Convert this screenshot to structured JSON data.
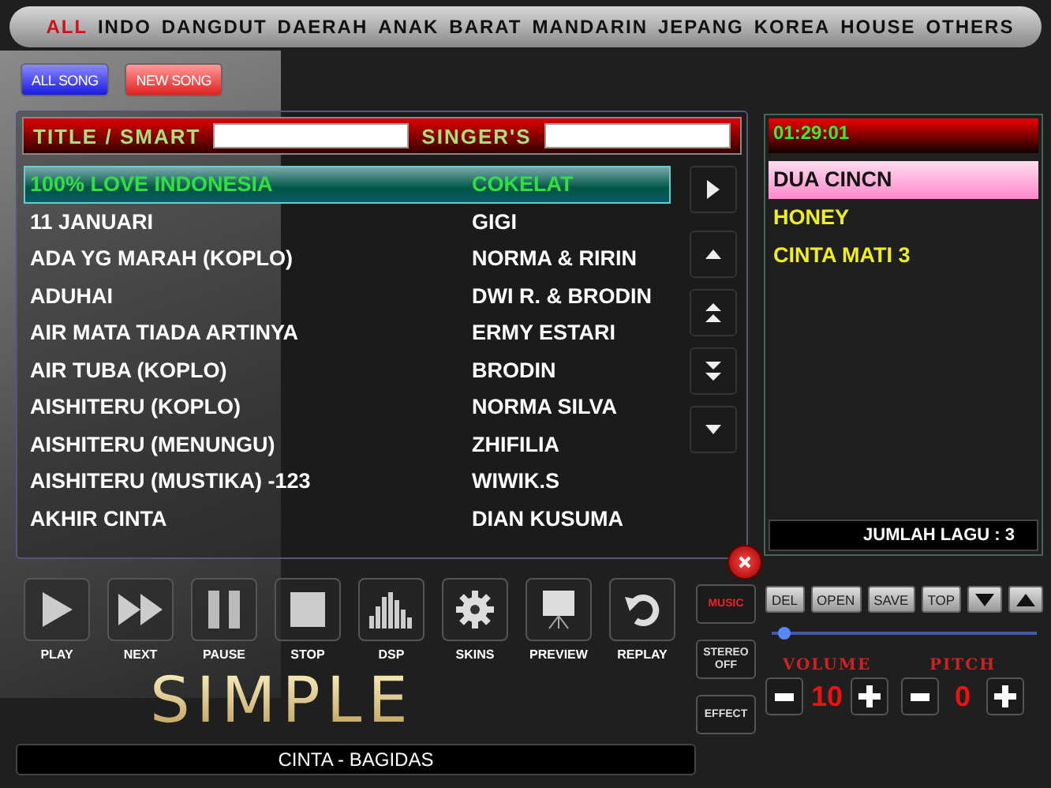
{
  "nav_tabs": [
    {
      "label": "ALL",
      "selected": true
    },
    {
      "label": "INDO",
      "selected": false
    },
    {
      "label": "DANGDUT",
      "selected": false
    },
    {
      "label": "DAERAH",
      "selected": false
    },
    {
      "label": "ANAK",
      "selected": false
    },
    {
      "label": "BARAT",
      "selected": false
    },
    {
      "label": "MANDARIN",
      "selected": false
    },
    {
      "label": "JEPANG",
      "selected": false
    },
    {
      "label": "KOREA",
      "selected": false
    },
    {
      "label": "HOUSE",
      "selected": false
    },
    {
      "label": "OTHERS",
      "selected": false
    }
  ],
  "list_buttons": [
    {
      "label": "ALL SONG",
      "kind": "all"
    },
    {
      "label": "NEW SONG",
      "kind": "new"
    }
  ],
  "search": {
    "title_label": "TITLE / SMART",
    "singer_label": "SINGER'S"
  },
  "songs": [
    {
      "title": "100% LOVE INDONESIA",
      "singer": "COKELAT",
      "selected": true
    },
    {
      "title": "11 JANUARI",
      "singer": "GIGI",
      "selected": false
    },
    {
      "title": "ADA YG MARAH (KOPLO)",
      "singer": "NORMA & RIRIN",
      "selected": false
    },
    {
      "title": "ADUHAI",
      "singer": "DWI R. & BRODIN",
      "selected": false
    },
    {
      "title": "AIR MATA TIADA ARTINYA",
      "singer": "ERMY ESTARI",
      "selected": false
    },
    {
      "title": "AIR TUBA (KOPLO)",
      "singer": "BRODIN",
      "selected": false
    },
    {
      "title": "AISHITERU (KOPLO)",
      "singer": "NORMA SILVA",
      "selected": false
    },
    {
      "title": "AISHITERU (MENUNGU)",
      "singer": "ZHIFILIA",
      "selected": false
    },
    {
      "title": "AISHITERU (MUSTIKA) -123",
      "singer": "WIWIK.S",
      "selected": false
    },
    {
      "title": "AKHIR CINTA",
      "singer": "DIAN KUSUMA",
      "selected": false
    }
  ],
  "queue": {
    "time": "01:29:01",
    "items": [
      {
        "title": "DUA CINCN",
        "selected": true
      },
      {
        "title": "HONEY",
        "selected": false
      },
      {
        "title": "CINTA MATI 3",
        "selected": false
      }
    ],
    "count": "JUMLAH LAGU : 3"
  },
  "controls": [
    {
      "label": "PLAY",
      "kind": "play"
    },
    {
      "label": "NEXT",
      "kind": "next"
    },
    {
      "label": "PAUSE",
      "kind": "pause"
    },
    {
      "label": "STOP",
      "kind": "stop"
    },
    {
      "label": "DSP",
      "kind": "dsp"
    },
    {
      "label": "SKINS",
      "kind": "skins"
    },
    {
      "label": "PREVIEW",
      "kind": "preview"
    },
    {
      "label": "REPLAY",
      "kind": "replay"
    }
  ],
  "logo": "SIMPLE",
  "now_playing": "CINTA - BAGIDAS",
  "modes": [
    {
      "label": "MUSIC",
      "on": true
    },
    {
      "label": "STEREO OFF",
      "on": false
    },
    {
      "label": "EFFECT",
      "on": false
    }
  ],
  "queue_buttons": [
    "DEL",
    "OPEN",
    "SAVE",
    "TOP"
  ],
  "position_slider": {
    "level": 0.05
  },
  "volume": {
    "label": "VOLUME",
    "value": "10"
  },
  "pitch": {
    "label": "PITCH",
    "value": "0"
  }
}
